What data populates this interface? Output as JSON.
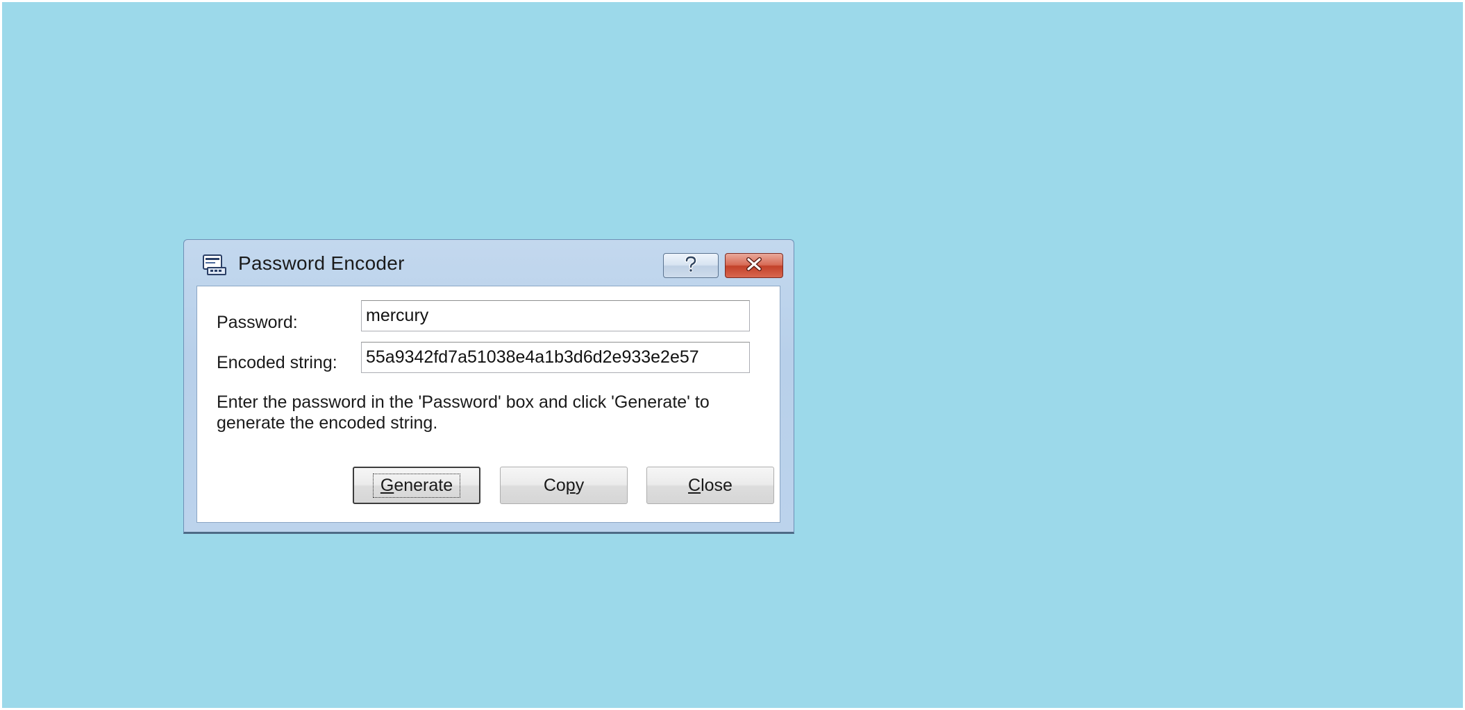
{
  "window": {
    "title": "Password Encoder",
    "help_button": "?",
    "close_button": "✕"
  },
  "form": {
    "password_label": "Password:",
    "password_value": "mercury",
    "encoded_label": "Encoded string:",
    "encoded_value": "55a9342fd7a51038e4a1b3d6d2e933e2e57"
  },
  "instructions": "Enter the password in the 'Password' box and click 'Generate' to generate the encoded string.",
  "buttons": {
    "generate": {
      "accel": "G",
      "rest": "enerate"
    },
    "copy": {
      "pre": "Co",
      "accel": "p",
      "rest": "y"
    },
    "close": {
      "accel": "C",
      "rest": "lose"
    }
  },
  "icons": {
    "app": "password-encoder-app-icon",
    "help": "question-mark-icon",
    "close": "close-x-icon"
  },
  "colors": {
    "desktop": "#9cd9ea",
    "close_button": "#c2412a",
    "titlebar": "#c3d8ee"
  }
}
